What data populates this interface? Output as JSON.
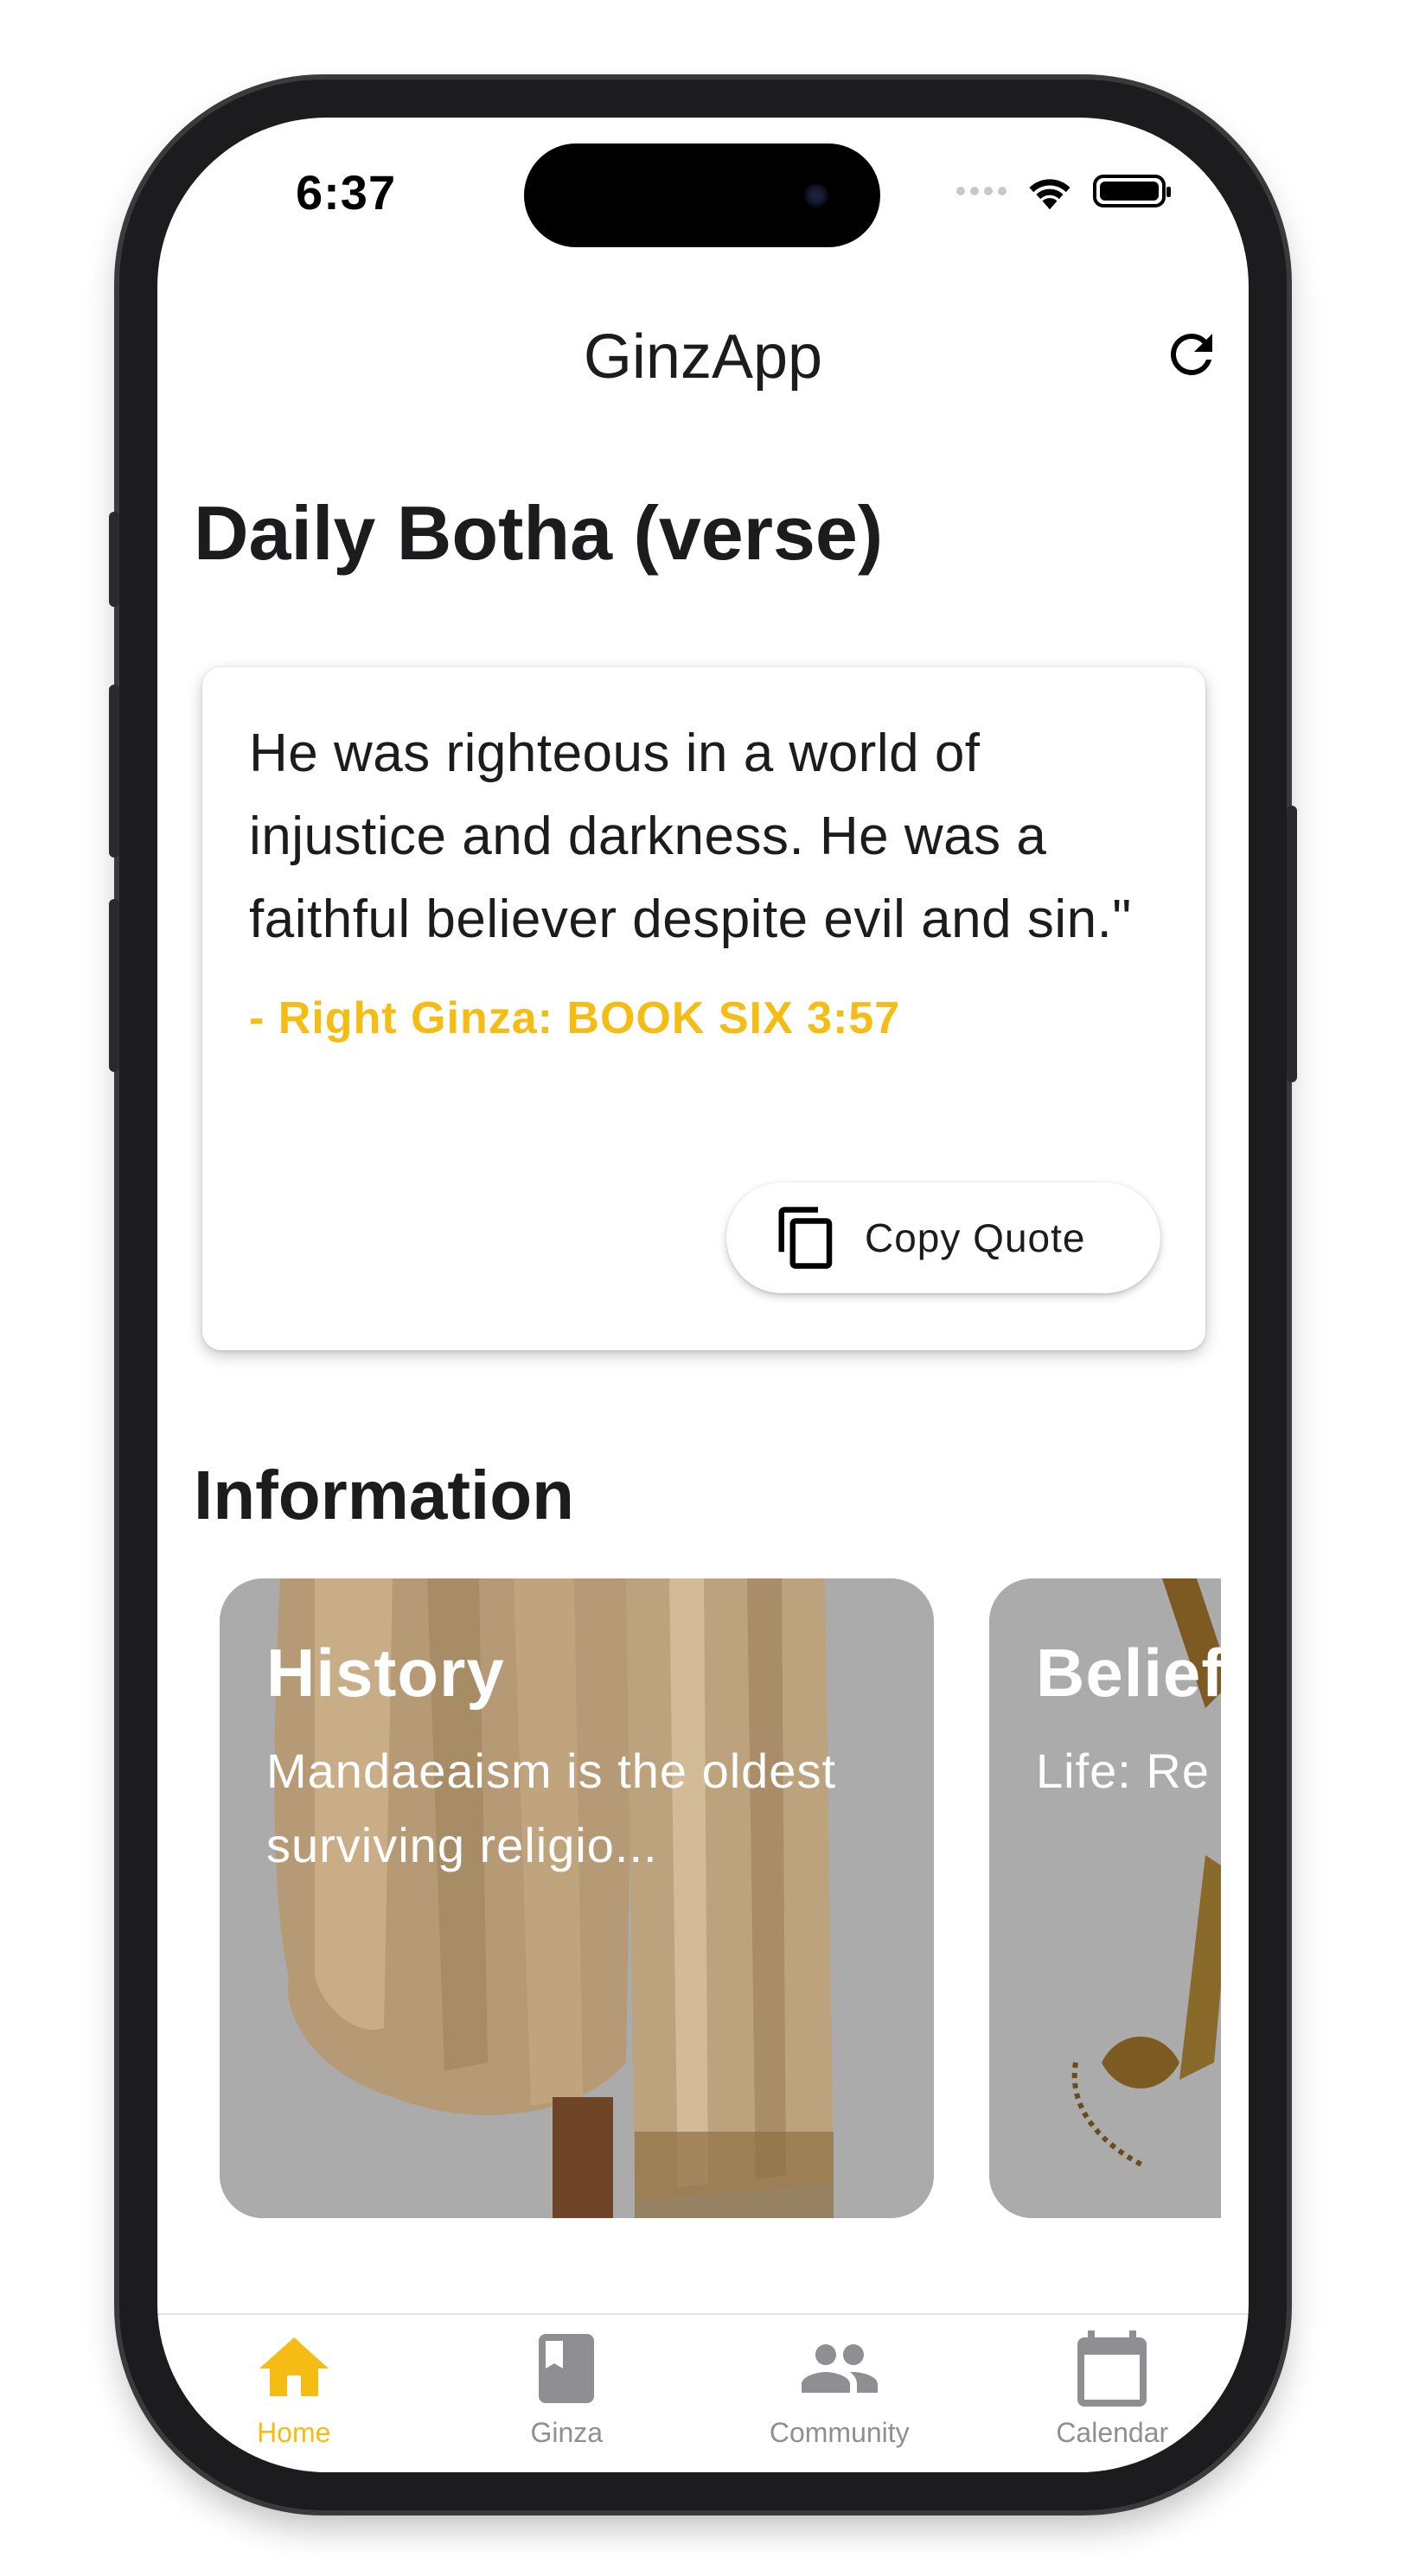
{
  "status": {
    "time": "6:37"
  },
  "app": {
    "title": "GinzApp"
  },
  "verse_section": {
    "title": "Daily Botha (verse)",
    "text": "He was righteous in a world of injustice and darkness. He was a faithful believer despite evil and sin.\"",
    "reference": "- Right Ginza: BOOK SIX 3:57",
    "copy_label": "Copy Quote"
  },
  "info_section": {
    "title": "Information",
    "cards": [
      {
        "title": "History",
        "description": "Mandaeaism is the oldest surviving religio..."
      },
      {
        "title": "Beliefs",
        "description": "Life: Re existence"
      }
    ]
  },
  "bottom_nav": {
    "items": [
      {
        "label": "Home",
        "icon": "home-icon",
        "active": true
      },
      {
        "label": "Ginza",
        "icon": "book-icon",
        "active": false
      },
      {
        "label": "Community",
        "icon": "people-icon",
        "active": false
      },
      {
        "label": "Calendar",
        "icon": "calendar-icon",
        "active": false
      }
    ]
  },
  "colors": {
    "accent": "#f5bd13",
    "inactive": "#8e8e93",
    "text": "#1c1c1e"
  }
}
